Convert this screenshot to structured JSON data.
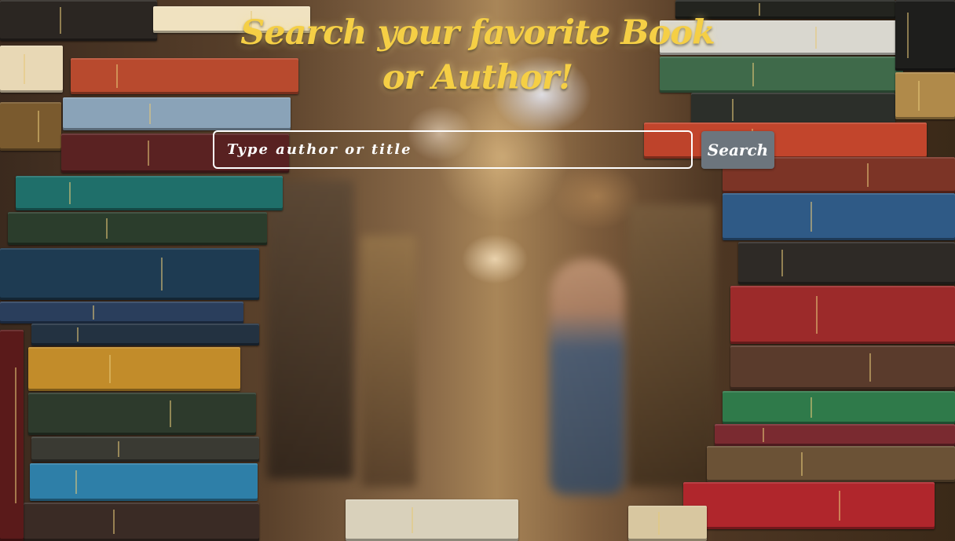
{
  "page": {
    "title": "Search your favorite Book or Author!"
  },
  "search": {
    "placeholder": "Type author or title",
    "value": "",
    "button_label": "Search"
  },
  "colors": {
    "title": "#f5cf45",
    "button_bg": "#6c757d",
    "input_border": "#ffffff"
  },
  "background": {
    "description_icon": "bookshelf-background",
    "left_stack_colors": [
      "#2b2622",
      "#f0e2c0",
      "#b84a2e",
      "#8aa3b8",
      "#5a2222",
      "#1f6f6a",
      "#2b3d2c",
      "#1e3b52",
      "#2a3e5c",
      "#c28c2a",
      "#2d3a2c",
      "#3a3a33",
      "#2e7fa8",
      "#3a2b25"
    ],
    "right_stack_colors": [
      "#23241f",
      "#d9d7cf",
      "#3f6a4a",
      "#2c2f2a",
      "#c2452c",
      "#7c3426",
      "#2f5a86",
      "#2e2a26",
      "#9c2a2a",
      "#5a3b2c",
      "#2f7a4a",
      "#7a2a30",
      "#6b5236",
      "#b0262c"
    ]
  }
}
